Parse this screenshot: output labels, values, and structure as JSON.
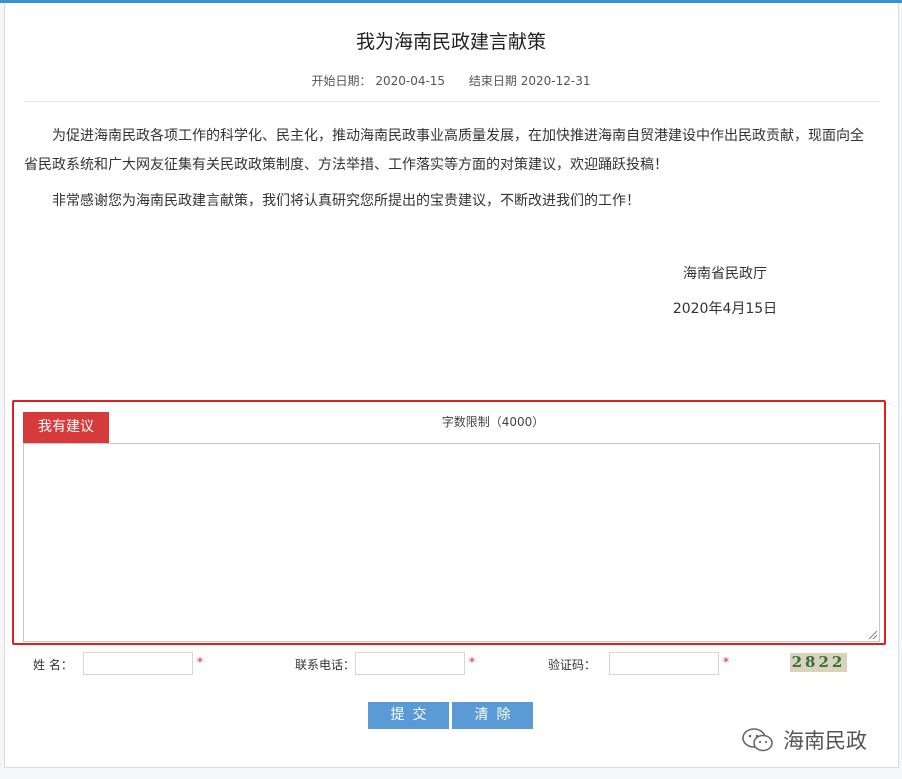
{
  "page": {
    "title": "我为海南民政建言献策",
    "start_label": "开始日期：",
    "start_date": "2020-04-15",
    "end_label": "结束日期",
    "end_date": "2020-12-31"
  },
  "intro": {
    "paragraph1": "为促进海南民政各项工作的科学化、民主化，推动海南民政事业高质量发展，在加快推进海南自贸港建设中作出民政贡献，现面向全省民政系统和广大网友征集有关民政政策制度、方法举措、工作落实等方面的对策建议，欢迎踊跃投稿！",
    "paragraph2": "非常感谢您为海南民政建言献策，我们将认真研究您所提出的宝贵建议，不断改进我们的工作！",
    "signature_org": "海南省民政厅",
    "signature_date": "2020年4月15日"
  },
  "suggestion": {
    "tab_label": "我有建议",
    "char_limit": "字数限制（4000）",
    "content_value": ""
  },
  "form": {
    "name_label": "姓 名：",
    "name_value": "",
    "phone_label": "联系电话：",
    "phone_value": "",
    "captcha_label": "验证码：",
    "captcha_value": "",
    "required_mark": "*",
    "captcha_image_text": "2822"
  },
  "buttons": {
    "submit": "提交",
    "clear": "清除"
  },
  "watermark": {
    "text": "海南民政",
    "icon": "wechat-icon"
  },
  "colors": {
    "accent": "#5b9bd5",
    "tab": "#d63a3a",
    "highlight_border": "#e02020",
    "topbar": "#3b8fd4"
  }
}
